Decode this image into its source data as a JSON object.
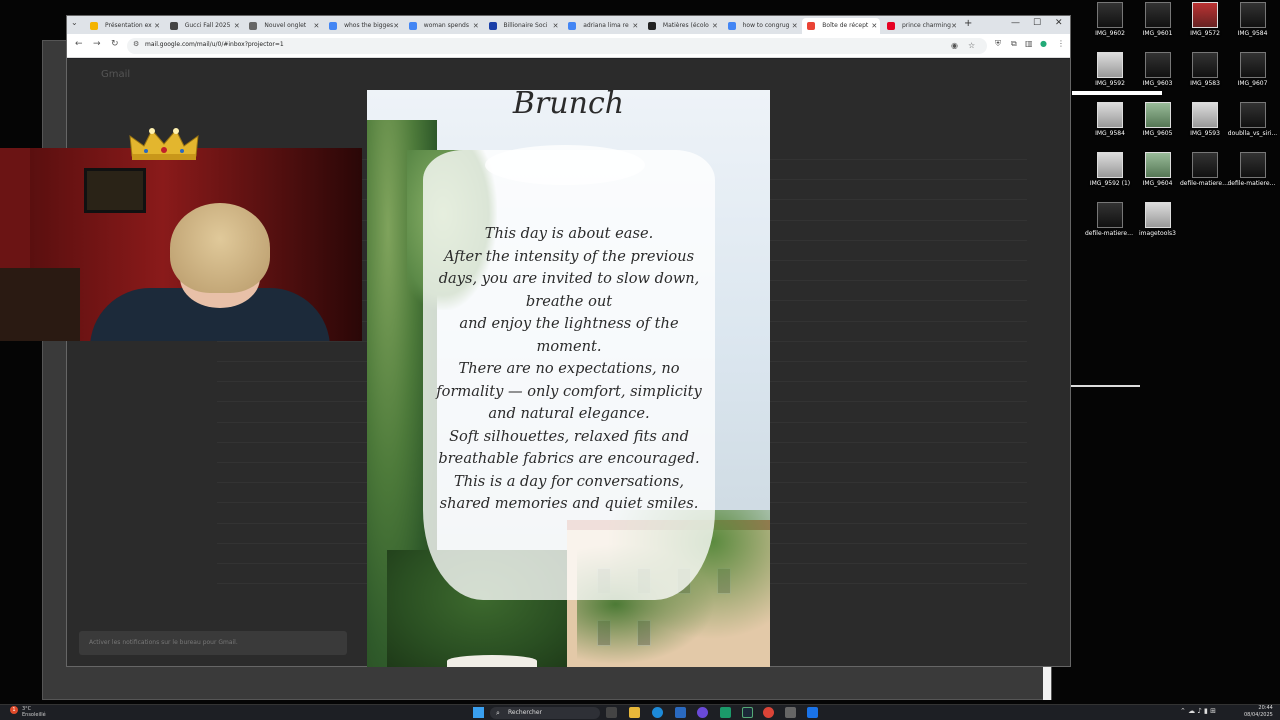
{
  "browser": {
    "tabs": [
      {
        "label": "Présentation ex",
        "color": "#f4b400"
      },
      {
        "label": "Gucci Fall 2025",
        "color": "#444444"
      },
      {
        "label": "Nouvel onglet",
        "color": "#666666"
      },
      {
        "label": "whos the bigges",
        "color": "#4285f4"
      },
      {
        "label": "woman spends",
        "color": "#4285f4"
      },
      {
        "label": "Billionaire Soci",
        "color": "#1a3fa8"
      },
      {
        "label": "adriana lima re",
        "color": "#4285f4"
      },
      {
        "label": "Matières (écolo",
        "color": "#222222"
      },
      {
        "label": "how to congrug",
        "color": "#4285f4"
      },
      {
        "label": "Boîte de récept",
        "color": "#ea4335"
      },
      {
        "label": "prince charming",
        "color": "#e60023"
      }
    ],
    "active_tab_index": 9,
    "url": "mail.google.com/mail/u/0/#inbox?projector=1"
  },
  "gmail": {
    "app_name": "Gmail",
    "toast_text": "Activer les notifications sur le bureau pour Gmail."
  },
  "flyer": {
    "title": "Brunch",
    "lines": [
      "This day is about ease.",
      "After the intensity of the previous",
      "days, you are invited to slow down,",
      "breathe out",
      "and enjoy the lightness of the",
      "moment.",
      "There are no expectations, no",
      "formality — only comfort, simplicity",
      "and natural elegance.",
      "Soft silhouettes, relaxed fits and",
      "breathable fabrics are encouraged.",
      "This is a day for conversations,",
      "shared memories and quiet smiles."
    ]
  },
  "desktop_icons": [
    {
      "label": "IMG_9602",
      "style": "dark"
    },
    {
      "label": "IMG_9601",
      "style": "dark"
    },
    {
      "label": "IMG_9572",
      "style": "red"
    },
    {
      "label": "IMG_9584",
      "style": "dark"
    },
    {
      "label": "IMG_9592",
      "style": "light"
    },
    {
      "label": "IMG_9603",
      "style": "dark"
    },
    {
      "label": "IMG_9583",
      "style": "dark"
    },
    {
      "label": "IMG_9607",
      "style": "dark"
    },
    {
      "label": "IMG_9584",
      "style": "light"
    },
    {
      "label": "IMG_9605",
      "style": "green"
    },
    {
      "label": "IMG_9593",
      "style": "light"
    },
    {
      "label": "doublla_vs_siri...",
      "style": "dark"
    },
    {
      "label": "IMG_9592 (1)",
      "style": "light"
    },
    {
      "label": "IMG_9604",
      "style": "green"
    },
    {
      "label": "defile-matieres...",
      "style": "dark"
    },
    {
      "label": "defile-matieres...",
      "style": "dark"
    },
    {
      "label": "defile-matieres...",
      "style": "dark"
    },
    {
      "label": "imagetools3",
      "style": "light"
    }
  ],
  "taskbar": {
    "weather_temp": "3°C",
    "weather_desc": "Ensoleillé",
    "notification_count": "1",
    "search_placeholder": "Rechercher",
    "time": "20:44",
    "date": "08/04/2025"
  }
}
